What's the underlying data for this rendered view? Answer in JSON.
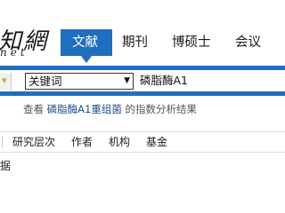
{
  "logo": {
    "glyphs": "知網",
    "sub": "net"
  },
  "nav": {
    "tabs": [
      {
        "label": "文献",
        "active": true
      },
      {
        "label": "期刊",
        "active": false
      },
      {
        "label": "博硕士",
        "active": false
      },
      {
        "label": "会议",
        "active": false
      }
    ]
  },
  "search": {
    "field_select": "关键词",
    "query": "磷脂酶A1"
  },
  "hint": {
    "prefix": "查看",
    "term": "磷脂酶A1重组菌",
    "suffix": "的指数分析结果"
  },
  "filters": {
    "items": [
      "研究层次",
      "作者",
      "机构",
      "基金"
    ]
  },
  "results": {
    "fragment": "据"
  },
  "colors": {
    "accent": "#1f6fbf",
    "scope_chevron": "#e69a2a",
    "link": "#1f4f8f"
  }
}
